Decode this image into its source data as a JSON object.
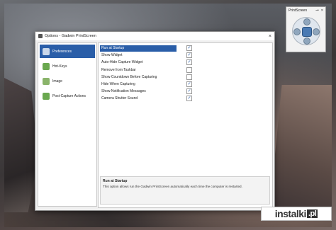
{
  "window": {
    "title": "Options - Gadwin PrintScreen",
    "close": "×"
  },
  "sidebar": {
    "items": [
      {
        "label": "Preferences",
        "icon": "preferences-icon",
        "color": "#c9d7ea",
        "active": true
      },
      {
        "label": "Hot-Keys",
        "icon": "hotkeys-icon",
        "color": "#6aa84f",
        "active": false
      },
      {
        "label": "Image",
        "icon": "image-icon",
        "color": "#8ab46a",
        "active": false
      },
      {
        "label": "Post-Capture Actions",
        "icon": "actions-icon",
        "color": "#6aa84f",
        "active": false
      }
    ]
  },
  "options": [
    {
      "label": "Run at Startup",
      "checked": true,
      "selected": true
    },
    {
      "label": "Show Widget",
      "checked": true,
      "selected": false
    },
    {
      "label": "Auto-Hide Capture Widget",
      "checked": true,
      "selected": false
    },
    {
      "label": "Remove from Taskbar",
      "checked": false,
      "selected": false
    },
    {
      "label": "Show Countdown Before Capturing",
      "checked": false,
      "selected": false
    },
    {
      "label": "Hide When Capturing",
      "checked": true,
      "selected": false
    },
    {
      "label": "Show Notification Messages",
      "checked": true,
      "selected": false
    },
    {
      "label": "Camera Shutter Sound",
      "checked": true,
      "selected": false
    }
  ],
  "description": {
    "title": "Run at Startup",
    "text": "This option allows run the Gadwin PrintScreen automatically each time the computer is restarted."
  },
  "widget": {
    "title": "PrintScreen",
    "pin": "⊸",
    "close": "×"
  },
  "watermark": {
    "text": "instalki",
    "suffix": ".pl"
  },
  "colors": {
    "accent": "#2a5ea8"
  }
}
